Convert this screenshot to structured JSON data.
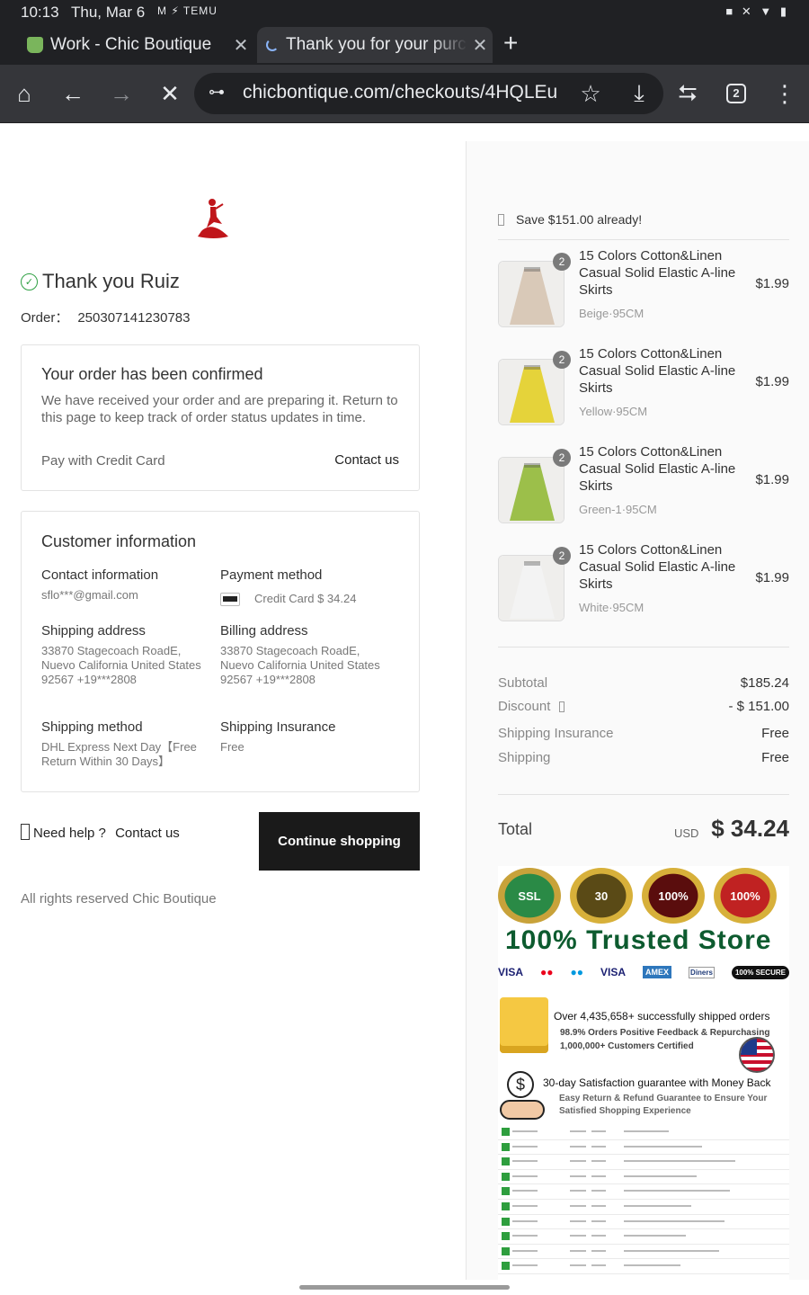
{
  "status_bar": {
    "time": "10:13",
    "date": "Thu, Mar 6",
    "notifications": "M ⚡ TEMU",
    "system_icons": "■ ✕ ▼ ▮"
  },
  "browser": {
    "tabs": [
      {
        "title": "Work - Chic Boutique",
        "icon": "shopify-icon",
        "close": "✕"
      },
      {
        "title": "Thank you for your purchase",
        "icon": "loading-spinner-icon",
        "close": "✕",
        "active": true
      }
    ],
    "new_tab": "+",
    "url": "chicbontique.com/checkouts/4HQLEu",
    "tab_count": "2",
    "icons": {
      "home": "⌂",
      "back": "←",
      "forward": "→",
      "stop": "✕",
      "site_info": "⊶",
      "bookmark": "☆",
      "download": "⤓",
      "share": "⮀",
      "menu": "⋮"
    }
  },
  "confirmation": {
    "check_icon": "✓",
    "title": "Thank you Ruiz",
    "order_label": "Order：",
    "order_number": "250307141230783",
    "confirm_card": {
      "heading": "Your order has been confirmed",
      "body": "We have received your order and are preparing it. Return to this page to keep track of order status updates in time.",
      "payment_note": "Pay with Credit Card",
      "contact_link": "Contact us"
    },
    "customer": {
      "heading": "Customer information",
      "contact_label": "Contact information",
      "contact_value": "sflo***@gmail.com",
      "payment_label": "Payment method",
      "payment_value": "Credit Card $ 34.24",
      "shipping_label": "Shipping address",
      "shipping_value": "33870 Stagecoach RoadE, Nuevo California United States 92567 +19***2808",
      "billing_label": "Billing address",
      "billing_value": "33870 Stagecoach RoadE, Nuevo California United States 92567 +19***2808",
      "method_label": "Shipping method",
      "method_value": "DHL Express Next Day【Free Return Within 30 Days】",
      "insurance_label": "Shipping Insurance",
      "insurance_value": "Free"
    },
    "help_text": "Need help ?",
    "help_link": "Contact us",
    "continue_button": "Continue shopping",
    "footer": "All rights reserved Chic Boutique"
  },
  "summary": {
    "save_text": "Save $151.00 already!",
    "items": [
      {
        "name": "15 Colors Cotton&Linen Casual Solid Elastic A-line Skirts",
        "variant": "Beige·95CM",
        "price": "$1.99",
        "qty": "2",
        "color": "#d9c9b8"
      },
      {
        "name": "15 Colors Cotton&Linen Casual Solid Elastic A-line Skirts",
        "variant": "Yellow·95CM",
        "price": "$1.99",
        "qty": "2",
        "color": "#e5d33a"
      },
      {
        "name": "15 Colors Cotton&Linen Casual Solid Elastic A-line Skirts",
        "variant": "Green-1·95CM",
        "price": "$1.99",
        "qty": "2",
        "color": "#9cbf4a"
      },
      {
        "name": "15 Colors Cotton&Linen Casual Solid Elastic A-line Skirts",
        "variant": "White·95CM",
        "price": "$1.99",
        "qty": "2",
        "color": "#f3f3f3"
      }
    ],
    "subtotal_label": "Subtotal",
    "subtotal_value": "$185.24",
    "discount_label": "Discount",
    "discount_value": "- $ 151.00",
    "insurance_label": "Shipping Insurance",
    "insurance_value": "Free",
    "shipping_label": "Shipping",
    "shipping_value": "Free",
    "total_label": "Total",
    "total_currency": "USD",
    "total_value": "$ 34.24"
  },
  "trust": {
    "badges": [
      "SSL",
      "30",
      "100%",
      "100%"
    ],
    "headline": "100% Trusted Store",
    "payments": [
      "VISA",
      "●●",
      "●●",
      "VISA",
      "AMEX",
      "Diners",
      "100% SECURE"
    ],
    "orders_line": "Over 4,435,658+ successfully shipped orders",
    "feedback_line": "98.9% Orders Positive Feedback & Repurchasing",
    "customers_line": "1,000,000+ Customers Certified",
    "guarantee_line": "30-day Satisfaction guarantee with Money Back",
    "refund_line": "Easy Return & Refund Guarantee to Ensure Your Satisfied Shopping Experience",
    "coin_symbol": "$"
  },
  "colors": {
    "chrome_bg": "#202124",
    "toolbar_bg": "#35363a",
    "button_bg": "#1a1a1a",
    "success_green": "#2ea043",
    "brand_red": "#c0161b"
  }
}
